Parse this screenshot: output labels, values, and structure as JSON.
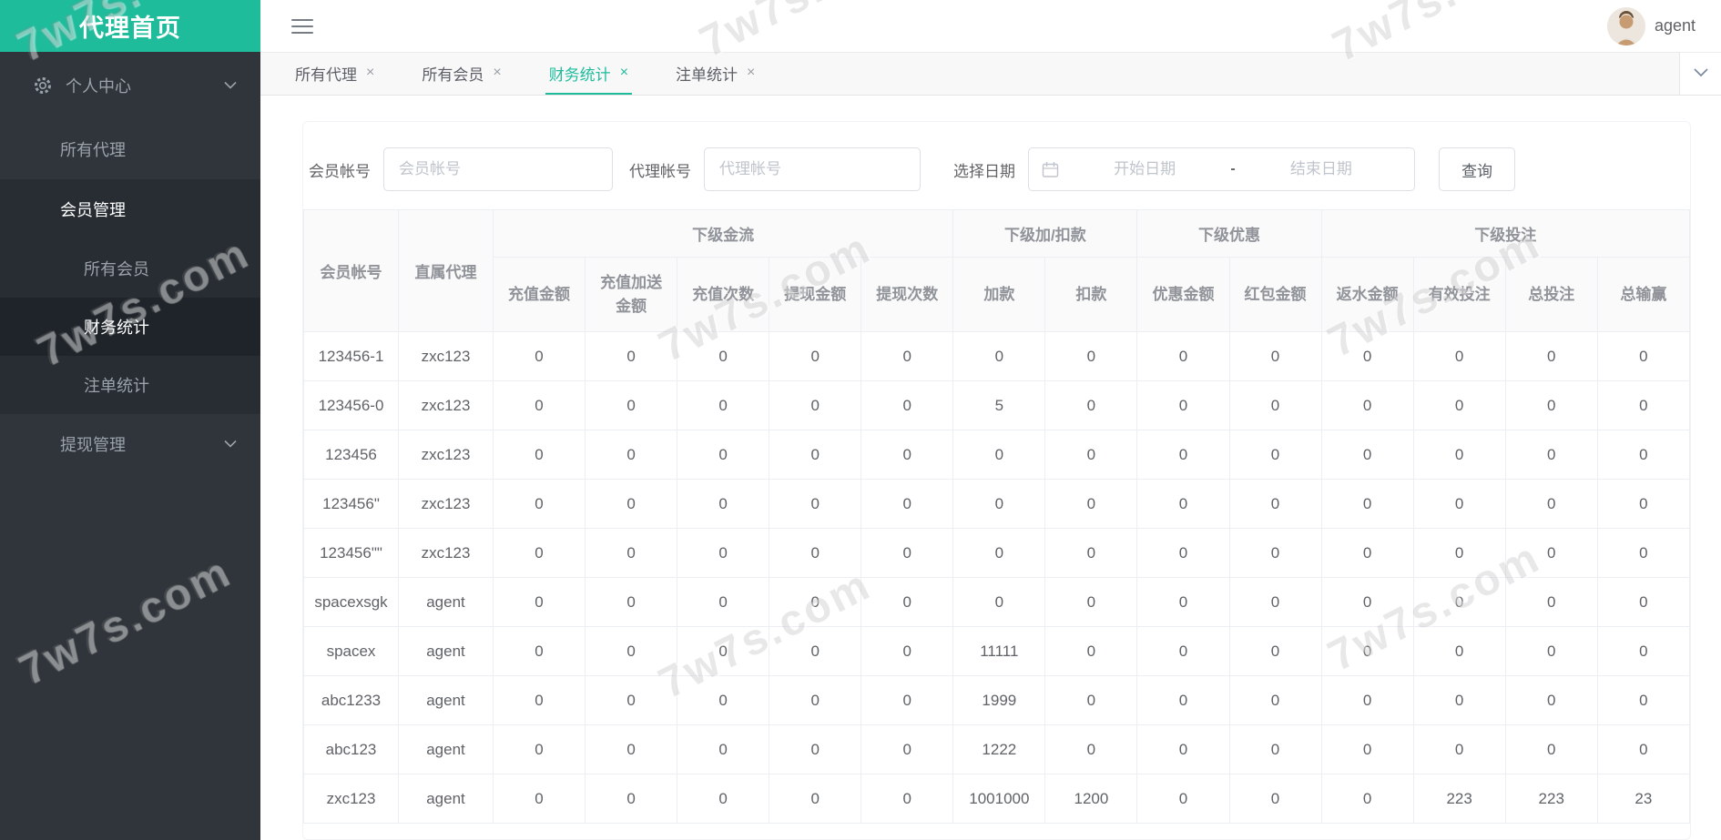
{
  "watermark": {
    "text": "7w7s.com"
  },
  "sidebar": {
    "logo": "代理首页",
    "items": [
      {
        "label": "个人中心"
      },
      {
        "label": "所有代理"
      },
      {
        "label": "会员管理"
      },
      {
        "label": "所有会员"
      },
      {
        "label": "财务统计"
      },
      {
        "label": "注单统计"
      },
      {
        "label": "提现管理"
      }
    ]
  },
  "header": {
    "username": "agent"
  },
  "tabs": [
    {
      "label": "所有代理",
      "close": "×"
    },
    {
      "label": "所有会员",
      "close": "×"
    },
    {
      "label": "财务统计",
      "close": "×"
    },
    {
      "label": "注单统计",
      "close": "×"
    }
  ],
  "filters": {
    "member_label": "会员帐号",
    "member_placeholder": "会员帐号",
    "agent_label": "代理帐号",
    "agent_placeholder": "代理帐号",
    "date_label": "选择日期",
    "date_start_placeholder": "开始日期",
    "date_separator": "-",
    "date_end_placeholder": "结束日期",
    "search_button": "查询"
  },
  "table": {
    "col_member": "会员帐号",
    "col_agent": "直属代理",
    "groups": [
      {
        "label": "下级金流",
        "cols": [
          "充值金额",
          "充值加送金额",
          "充值次数",
          "提现金额",
          "提现次数"
        ]
      },
      {
        "label": "下级加/扣款",
        "cols": [
          "加款",
          "扣款"
        ]
      },
      {
        "label": "下级优惠",
        "cols": [
          "优惠金额",
          "红包金额"
        ]
      },
      {
        "label": "下级投注",
        "cols": [
          "返水金额",
          "有效投注",
          "总投注",
          "总输赢"
        ]
      }
    ],
    "rows": [
      {
        "member": "123456-1",
        "agent": "zxc123",
        "values": [
          0,
          0,
          0,
          0,
          0,
          0,
          0,
          0,
          0,
          0,
          0,
          0,
          0
        ]
      },
      {
        "member": "123456-0",
        "agent": "zxc123",
        "values": [
          0,
          0,
          0,
          0,
          0,
          5,
          0,
          0,
          0,
          0,
          0,
          0,
          0
        ]
      },
      {
        "member": "123456",
        "agent": "zxc123",
        "values": [
          0,
          0,
          0,
          0,
          0,
          0,
          0,
          0,
          0,
          0,
          0,
          0,
          0
        ]
      },
      {
        "member": "123456\"",
        "agent": "zxc123",
        "values": [
          0,
          0,
          0,
          0,
          0,
          0,
          0,
          0,
          0,
          0,
          0,
          0,
          0
        ]
      },
      {
        "member": "123456\"\"",
        "agent": "zxc123",
        "values": [
          0,
          0,
          0,
          0,
          0,
          0,
          0,
          0,
          0,
          0,
          0,
          0,
          0
        ]
      },
      {
        "member": "spacexsgk",
        "agent": "agent",
        "values": [
          0,
          0,
          0,
          0,
          0,
          0,
          0,
          0,
          0,
          0,
          0,
          0,
          0
        ]
      },
      {
        "member": "spacex",
        "agent": "agent",
        "values": [
          0,
          0,
          0,
          0,
          0,
          11111,
          0,
          0,
          0,
          0,
          0,
          0,
          0
        ]
      },
      {
        "member": "abc1233",
        "agent": "agent",
        "values": [
          0,
          0,
          0,
          0,
          0,
          1999,
          0,
          0,
          0,
          0,
          0,
          0,
          0
        ]
      },
      {
        "member": "abc123",
        "agent": "agent",
        "values": [
          0,
          0,
          0,
          0,
          0,
          1222,
          0,
          0,
          0,
          0,
          0,
          0,
          0
        ]
      },
      {
        "member": "zxc123",
        "agent": "agent",
        "values": [
          0,
          0,
          0,
          0,
          0,
          1001000,
          1200,
          0,
          0,
          0,
          223,
          223,
          23
        ]
      }
    ]
  }
}
